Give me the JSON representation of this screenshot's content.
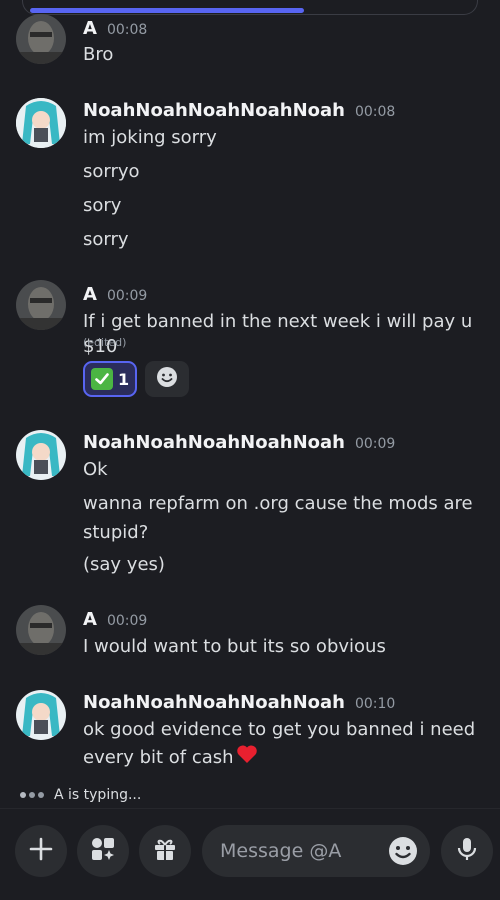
{
  "progress": {
    "fraction": 0.6,
    "color": "#5865f2"
  },
  "messages": [
    {
      "author": "A",
      "time": "00:08",
      "lines": [
        "Bro"
      ],
      "avatar": "photo-avatar"
    },
    {
      "author": "NoahNoahNoahNoahNoah",
      "time": "00:08",
      "lines": [
        "im joking sorry",
        "sorryo",
        "sory",
        "sorry"
      ],
      "avatar": "miku-avatar"
    },
    {
      "author": "A",
      "time": "00:09",
      "lines": [
        "If i get banned in the next week i will pay u $10"
      ],
      "edited": "(edited)",
      "avatar": "photo-avatar",
      "reaction": {
        "emoji": "check-mark-icon",
        "count": "1"
      }
    },
    {
      "author": "NoahNoahNoahNoahNoah",
      "time": "00:09",
      "lines": [
        "Ok",
        "wanna repfarm on .org cause the mods are",
        "stupid?",
        "(say yes)"
      ],
      "avatar": "miku-avatar"
    },
    {
      "author": "A",
      "time": "00:09",
      "lines": [
        "I would want to but its so obvious"
      ],
      "avatar": "photo-avatar"
    },
    {
      "author": "NoahNoahNoahNoahNoah",
      "time": "00:10",
      "lines": [
        "ok good evidence to get you banned i need",
        "every bit of cash"
      ],
      "heart": "red-heart-icon",
      "avatar": "miku-avatar"
    }
  ],
  "typing": {
    "text": "A is typing..."
  },
  "composer": {
    "placeholder": "Message @A",
    "buttons": [
      "plus-icon",
      "apps-icon",
      "gift-icon",
      "emoji-icon",
      "microphone-icon"
    ]
  },
  "colors": {
    "background": "#1c1d22",
    "accent": "#5865f2",
    "input_bg": "#2b2d31"
  }
}
